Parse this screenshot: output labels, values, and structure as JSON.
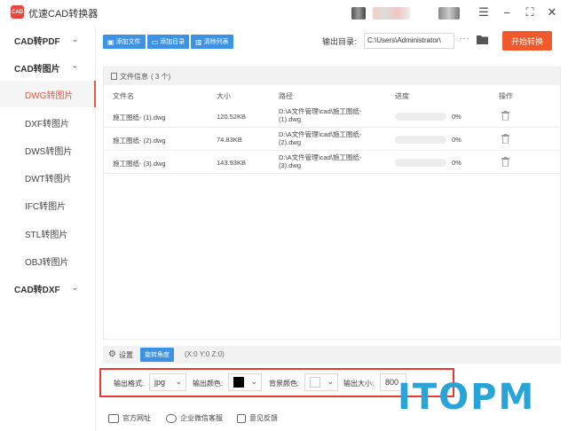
{
  "app": {
    "logo_text": "CAD",
    "title": "优速CAD转换器"
  },
  "window_controls": {
    "menu": "☰",
    "minimize": "−",
    "maximize": "⛶",
    "close": "✕"
  },
  "sidebar": {
    "groups": [
      {
        "label": "CAD转PDF",
        "chevron": "⌄"
      },
      {
        "label": "CAD转图片",
        "chevron": "⌃"
      },
      {
        "label": "CAD转DXF",
        "chevron": "⌄"
      }
    ],
    "items": [
      {
        "label": "DWG转图片",
        "active": true
      },
      {
        "label": "DXF转图片"
      },
      {
        "label": "DWS转图片"
      },
      {
        "label": "DWT转图片"
      },
      {
        "label": "IFC转图片"
      },
      {
        "label": "STL转图片"
      },
      {
        "label": "OBJ转图片"
      }
    ]
  },
  "toolbar": {
    "add_file": "添加文件",
    "add_dir": "添加目录",
    "clear_list": "清除列表",
    "output_dir_label": "输出目录:",
    "output_dir_value": "C:\\Users\\Administrator\\",
    "more": "···",
    "start": "开始转换"
  },
  "file_panel": {
    "header_label": "文件信息",
    "header_count": "( 3 个)",
    "columns": {
      "name": "文件名",
      "size": "大小",
      "path": "路径",
      "progress": "进度",
      "action": "操作"
    },
    "rows": [
      {
        "name": "施工图纸- (1).dwg",
        "size": "120.52KB",
        "path1": "D:\\A文件管理\\cad\\施工图纸-",
        "path2": "(1).dwg",
        "progress": "0%",
        "progress_value": 0
      },
      {
        "name": "施工图纸- (2).dwg",
        "size": "74.83KB",
        "path1": "D:\\A文件管理\\cad\\施工图纸-",
        "path2": "(2).dwg",
        "progress": "0%",
        "progress_value": 0
      },
      {
        "name": "施工图纸- (3).dwg",
        "size": "143.93KB",
        "path1": "D:\\A文件管理\\cad\\施工图纸-",
        "path2": "(3).dwg",
        "progress": "0%",
        "progress_value": 0
      }
    ]
  },
  "settings": {
    "label": "设置",
    "rotate_tab": "旋转角度",
    "coords": "(X:0 Y:0 Z:0)"
  },
  "options": {
    "format_label": "输出格式:",
    "format_value": "jpg",
    "color_label": "输出颜色:",
    "color_value": "#000000",
    "bg_label": "背景颜色:",
    "bg_value": "#ffffff",
    "size_label": "输出大小:",
    "size_value": "800"
  },
  "footer": {
    "website": "官方网址",
    "wechat": "企业微信客服",
    "feedback": "意见反馈"
  },
  "watermark": "ITOPM",
  "colors": {
    "accent": "#f0592b",
    "blue": "#3d92e4",
    "highlight": "#e53a32"
  }
}
